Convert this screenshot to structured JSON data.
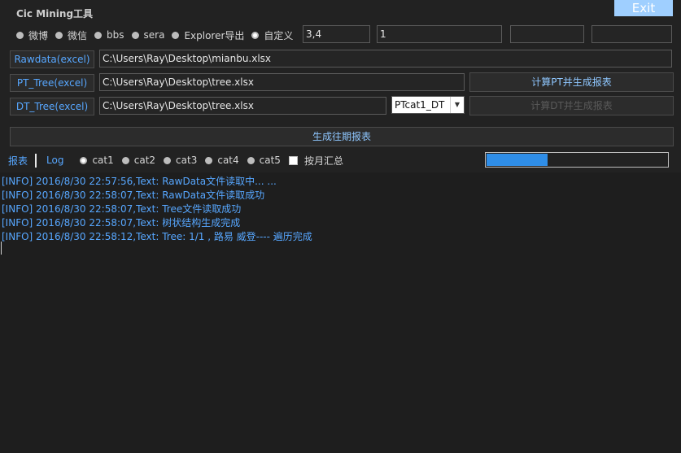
{
  "app": {
    "title": "Cic Mining工具",
    "exit_label": "Exit"
  },
  "sources": {
    "options": [
      {
        "label": "微博",
        "checked": false
      },
      {
        "label": "微信",
        "checked": false
      },
      {
        "label": "bbs",
        "checked": false
      },
      {
        "label": "sera",
        "checked": false
      },
      {
        "label": "Explorer导出",
        "checked": false
      },
      {
        "label": "自定义",
        "checked": true
      }
    ],
    "field1": "3,4",
    "field2": "1",
    "field3": "",
    "field4": ""
  },
  "files": {
    "rawdata_label": "Rawdata(excel)",
    "rawdata_path": "C:\\Users\\Ray\\Desktop\\mianbu.xlsx",
    "pt_label": "PT_Tree(excel)",
    "pt_path": "C:\\Users\\Ray\\Desktop\\tree.xlsx",
    "dt_label": "DT_Tree(excel)",
    "dt_path": "C:\\Users\\Ray\\Desktop\\tree.xlsx",
    "dt_combo": "PTcat1_DT"
  },
  "actions": {
    "pt_report": "计算PT并生成报表",
    "dt_report": "计算DT并生成报表",
    "history_report": "生成往期报表"
  },
  "tabs": {
    "report": "报表",
    "log": "Log"
  },
  "categories": [
    {
      "label": "cat1",
      "checked": true
    },
    {
      "label": "cat2",
      "checked": false
    },
    {
      "label": "cat3",
      "checked": false
    },
    {
      "label": "cat4",
      "checked": false
    },
    {
      "label": "cat5",
      "checked": false
    }
  ],
  "monthly": {
    "label": "按月汇总",
    "checked": false
  },
  "progress": {
    "fraction": 0.34
  },
  "log": [
    "[INFO] 2016/8/30 22:57:56,Text: RawData文件读取中... ...",
    "[INFO] 2016/8/30 22:58:07,Text: RawData文件读取成功",
    "[INFO] 2016/8/30 22:58:07,Text: Tree文件读取成功",
    "[INFO] 2016/8/30 22:58:07,Text: 树状结构生成完成",
    "[INFO] 2016/8/30 22:58:12,Text:    Tree: 1/1 , 路易 威登---- 遍历完成"
  ],
  "colors": {
    "accent": "#57a7ff",
    "progress": "#2f8ee8",
    "exit": "#9fcfff"
  }
}
